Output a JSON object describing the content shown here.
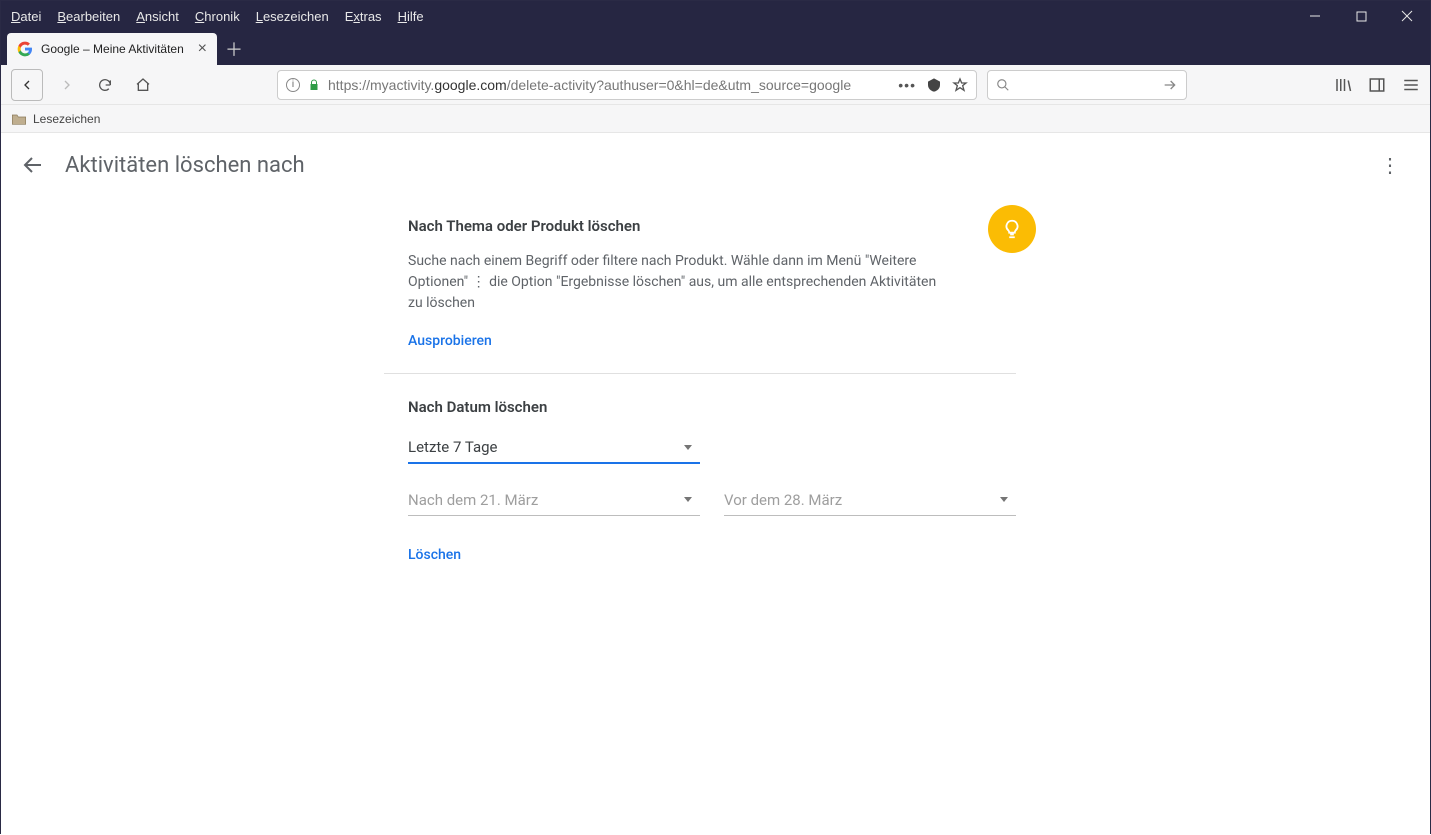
{
  "browser": {
    "menus": [
      "Datei",
      "Bearbeiten",
      "Ansicht",
      "Chronik",
      "Lesezeichen",
      "Extras",
      "Hilfe"
    ],
    "tab_title": "Google – Meine Aktivitäten",
    "url_prefix": "https://myactivity.",
    "url_domain": "google.com",
    "url_path": "/delete-activity?authuser=0&hl=de&utm_source=google",
    "bookmark_label": "Lesezeichen"
  },
  "page": {
    "title": "Aktivitäten löschen nach",
    "section1": {
      "title": "Nach Thema oder Produkt löschen",
      "text_a": "Suche nach einem Begriff oder filtere nach Produkt. Wähle dann im Menü \"Weitere Optionen\" ",
      "text_b": " die Option \"Ergebnisse löschen\" aus, um alle entsprechenden Aktivitäten zu löschen",
      "action": "Ausprobieren"
    },
    "section2": {
      "title": "Nach Datum löschen",
      "range_select": "Letzte 7 Tage",
      "after": "Nach dem 21. März",
      "before": "Vor dem 28. März",
      "action": "Löschen"
    }
  }
}
